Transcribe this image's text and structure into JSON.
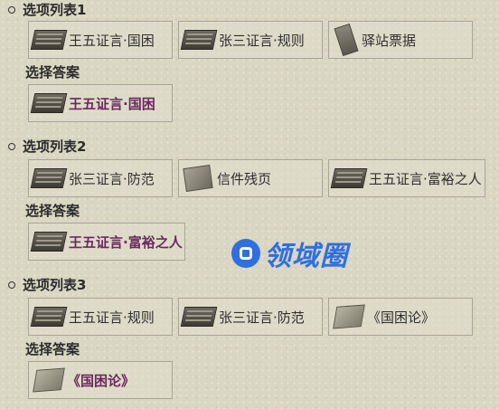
{
  "sections": [
    {
      "title": "选项列表1",
      "answer_title": "选择答案",
      "options": [
        "王五证言·国困",
        "张三证言·规则",
        "驿站票据"
      ],
      "answer": "王五证言·国困"
    },
    {
      "title": "选项列表2",
      "answer_title": "选择答案",
      "options": [
        "张三证言·防范",
        "信件残页",
        "王五证言·富裕之人"
      ],
      "answer": "王五证言·富裕之人"
    },
    {
      "title": "选项列表3",
      "answer_title": "选择答案",
      "options": [
        "王五证言·规则",
        "张三证言·防范",
        "《国困论》"
      ],
      "answer": "《国困论》"
    }
  ],
  "icons": {
    "testimony": "book-icon",
    "ticket": "ticket-icon",
    "letter": "letter-icon",
    "scroll": "scroll-icon"
  },
  "watermark": "领域圈",
  "colors": {
    "answer_text": "#6a2a5e",
    "watermark": "#2f6fe0",
    "background": "#d9d6c2"
  }
}
